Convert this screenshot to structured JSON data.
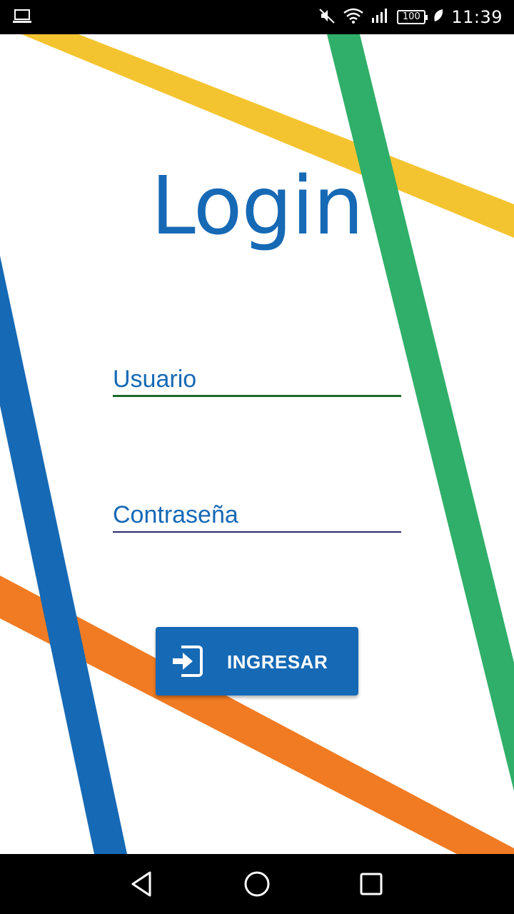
{
  "status_bar": {
    "time": "11:39",
    "battery": "100",
    "icons": [
      "laptop-icon",
      "mute-icon",
      "wifi-icon",
      "signal-icon",
      "battery-icon",
      "leaf-icon"
    ]
  },
  "login": {
    "title": "Login",
    "username_placeholder": "Usuario",
    "password_placeholder": "Contraseña",
    "submit_label": "INGRESAR",
    "submit_icon": "login-enter-icon"
  },
  "colors": {
    "primary": "#1669b5",
    "stripe_yellow": "#f4c430",
    "stripe_green": "#2faf69",
    "stripe_blue": "#1669b5",
    "stripe_orange": "#f07b22"
  },
  "nav_bar": {
    "icons": [
      "back-icon",
      "home-icon",
      "recents-icon"
    ]
  }
}
